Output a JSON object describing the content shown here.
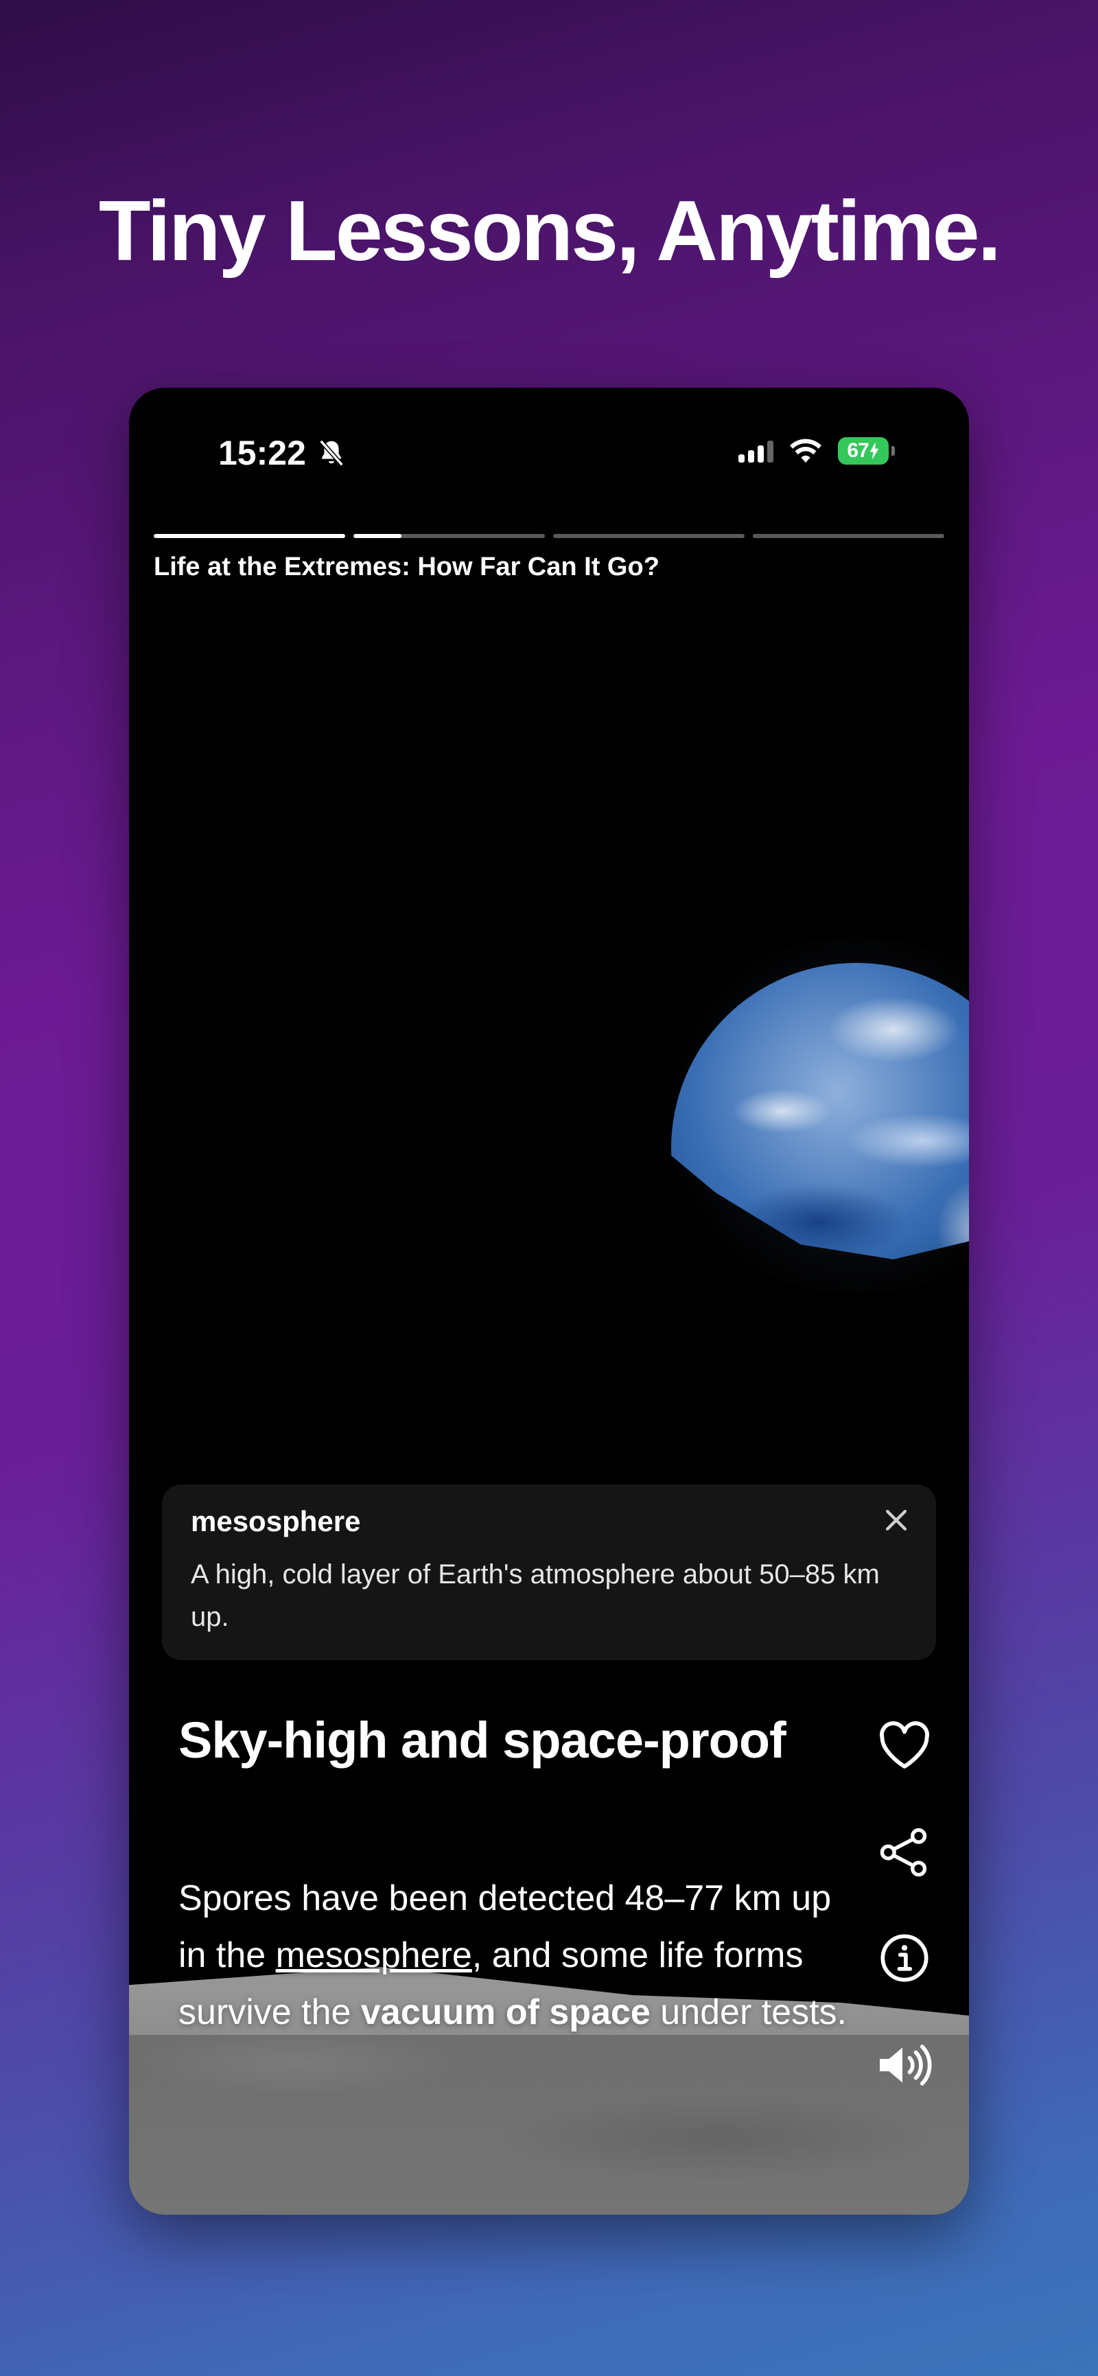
{
  "headline": "Tiny Lessons, Anytime.",
  "status_bar": {
    "time": "15:22",
    "battery": "67",
    "icons": [
      "bell-slash-icon",
      "cellular-signal-icon",
      "wifi-icon",
      "battery-charging-icon"
    ],
    "battery_color": "#34c759"
  },
  "progress": {
    "segments": 4,
    "current_index": 1,
    "current_fraction": 0.25
  },
  "story_title": "Life at the Extremes: How Far Can It Go?",
  "definition": {
    "term": "mesosphere",
    "text": "A high, cold layer of Earth's atmosphere about 50–85 km up."
  },
  "card": {
    "title": "Sky-high and space-proof",
    "body_1": "Spores have been detected 48–77 km up in the ",
    "body_link": "mesosphere",
    "body_2": ", and some life forms survive the ",
    "body_strong": "vacuum of space",
    "body_3": " under tests."
  },
  "actions": [
    "heart-icon",
    "share-icon",
    "info-icon",
    "speaker-icon"
  ]
}
